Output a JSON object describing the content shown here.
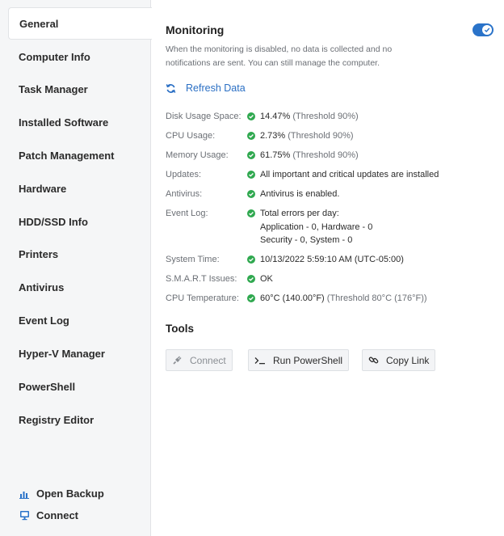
{
  "sidebar": {
    "items": [
      {
        "label": "General",
        "active": true
      },
      {
        "label": "Computer Info"
      },
      {
        "label": "Task Manager"
      },
      {
        "label": "Installed Software"
      },
      {
        "label": "Patch Management"
      },
      {
        "label": "Hardware"
      },
      {
        "label": "HDD/SSD Info"
      },
      {
        "label": "Printers"
      },
      {
        "label": "Antivirus"
      },
      {
        "label": "Event Log"
      },
      {
        "label": "Hyper-V Manager"
      },
      {
        "label": "PowerShell"
      },
      {
        "label": "Registry Editor"
      }
    ],
    "footer": {
      "open_backup": "Open Backup",
      "connect": "Connect"
    }
  },
  "monitoring": {
    "title": "Monitoring",
    "description": "When the monitoring is disabled, no data is collected and no notifications are sent. You can still manage the computer.",
    "enabled": true,
    "refresh_label": "Refresh Data"
  },
  "status": {
    "disk": {
      "label": "Disk Usage Space:",
      "value": "14.47%",
      "note": "(Threshold 90%)"
    },
    "cpu": {
      "label": "CPU Usage:",
      "value": "2.73%",
      "note": "(Threshold 90%)"
    },
    "memory": {
      "label": "Memory Usage:",
      "value": "61.75%",
      "note": "(Threshold 90%)"
    },
    "updates": {
      "label": "Updates:",
      "value": "All important and critical updates are installed"
    },
    "antivirus": {
      "label": "Antivirus:",
      "value": "Antivirus is enabled."
    },
    "eventlog": {
      "label": "Event Log:",
      "line1": "Total errors per day:",
      "line2": "Application - 0, Hardware - 0",
      "line3": "Security - 0, System - 0"
    },
    "systemtime": {
      "label": "System Time:",
      "value": "10/13/2022 5:59:10 AM (UTC-05:00)"
    },
    "smart": {
      "label": "S.M.A.R.T Issues:",
      "value": "OK"
    },
    "cputemp": {
      "label": "CPU Temperature:",
      "value": "60°C (140.00°F)",
      "note": "(Threshold 80°C (176°F))"
    }
  },
  "tools": {
    "title": "Tools",
    "connect": "Connect",
    "powershell": "Run PowerShell",
    "copy_link": "Copy Link"
  },
  "colors": {
    "accent": "#2a73c9",
    "success": "#2fa84f"
  },
  "icons": {
    "refresh": "refresh-icon",
    "check": "check-circle-icon",
    "plug": "plug-icon",
    "terminal": "terminal-icon",
    "link": "link-icon",
    "chart": "bar-chart-icon",
    "monitor": "monitor-icon"
  }
}
